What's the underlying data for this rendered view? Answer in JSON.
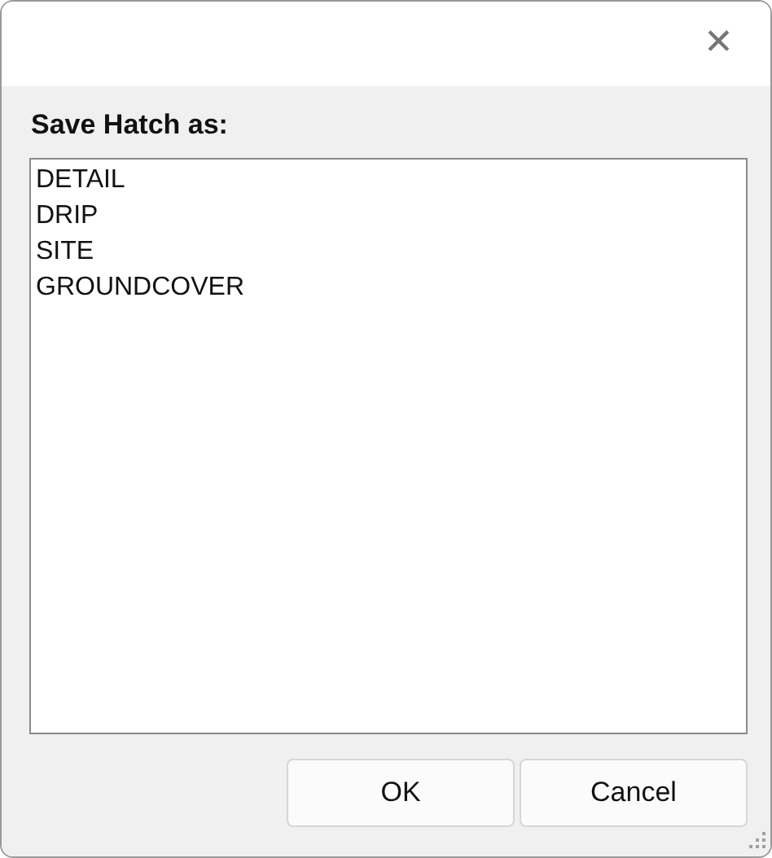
{
  "window": {
    "close_symbol": "✕"
  },
  "label": "Save Hatch as:",
  "list": {
    "items": [
      {
        "text": "DETAIL"
      },
      {
        "text": "DRIP"
      },
      {
        "text": "SITE"
      },
      {
        "text": "GROUNDCOVER"
      }
    ]
  },
  "buttons": [
    "OK",
    "Cancel"
  ]
}
